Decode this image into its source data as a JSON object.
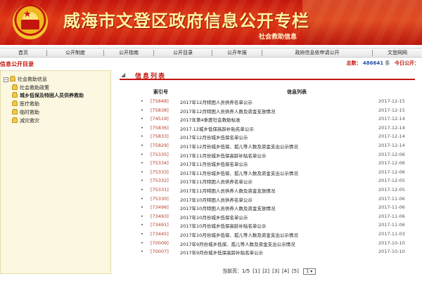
{
  "banner": {
    "title": "威海市文登区政府信息公开专栏",
    "subtitle": "社会救助信息"
  },
  "nav": {
    "items": [
      "首页",
      "公开制度",
      "公开指南",
      "公开目录",
      "公开年报",
      "政府信息依申请公开",
      "文登网网"
    ]
  },
  "sidebar": {
    "title": "信息公开目录",
    "root": "社会救助信息",
    "items": [
      {
        "label": "社会救助政策"
      },
      {
        "label": "城乡低保及特困人员供养救助"
      },
      {
        "label": "医疗救助"
      },
      {
        "label": "临时救助"
      },
      {
        "label": "减灾救灾"
      }
    ]
  },
  "stats": {
    "total_label": "总数：",
    "total_value": "486641",
    "unit": "条",
    "today_label": "今日公开："
  },
  "main": {
    "section_title": "信息列表",
    "col_code": "索引号",
    "col_title": "信息列表",
    "rows": [
      {
        "code": "[75848]",
        "title": "2017年12月特困人员供养名单公示",
        "date": "2017-12-15"
      },
      {
        "code": "[75838]",
        "title": "2017年12月特困人员供养人数及资金支放情况",
        "date": "2017-12-15"
      },
      {
        "code": "[74519]",
        "title": "2017年第4季度社会救助标准",
        "date": "2017-12-14"
      },
      {
        "code": "[75836]",
        "title": "2017.12城乡低保高龄补贴名单公示",
        "date": "2017-12-14"
      },
      {
        "code": "[75833]",
        "title": "2017年12月份城乡低保名单公示",
        "date": "2017-12-14"
      },
      {
        "code": "[75829]",
        "title": "2017年12月份城乡低保、孤儿等人数及资金支出公示情况",
        "date": "2017-12-14"
      },
      {
        "code": "[75335]",
        "title": "2017年11月份城乡低保高龄补贴名单公示",
        "date": "2017-12-06"
      },
      {
        "code": "[75334]",
        "title": "2017年11月份城乡低保名单公示",
        "date": "2017-12-06"
      },
      {
        "code": "[75333]",
        "title": "2017年11月份城乡低保、孤儿等人数及资金支出公示情况",
        "date": "2017-12-06"
      },
      {
        "code": "[75332]",
        "title": "2017年11月特困人员供养名单公示",
        "date": "2017-12-05"
      },
      {
        "code": "[75331]",
        "title": "2017年11月特困人员供养人数及资金支放情况",
        "date": "2017-12-05"
      },
      {
        "code": "[75330]",
        "title": "2017年10月特困人员供养名单公示",
        "date": "2017-11-06"
      },
      {
        "code": "[73496]",
        "title": "2017年10月特困人员供养人数及资金支放情况",
        "date": "2017-11-06"
      },
      {
        "code": "[73493]",
        "title": "2017年10月份城乡低保名单公示",
        "date": "2017-11-06"
      },
      {
        "code": "[73491]",
        "title": "2017年10月份城乡低保高龄补贴名单公示",
        "date": "2017-11-06"
      },
      {
        "code": "[73445]",
        "title": "2017年10月份城乡低保、孤儿等人数及资金支出公示情况",
        "date": "2017-11-03"
      },
      {
        "code": "[70009]",
        "title": "2017年9月份城乡低保、孤儿等人数及资金支出公示情况",
        "date": "2017-10-10"
      },
      {
        "code": "[70007]",
        "title": "2017年9月份城乡低保高龄补贴名单公示",
        "date": "2017-10-10"
      }
    ]
  },
  "pager": {
    "label": "当前页：1/5",
    "pages": [
      "[1]",
      "[2]",
      "[3]",
      "[4]",
      "[5]"
    ],
    "select_value": "1"
  },
  "colors": {
    "brand_red": "#c4160e",
    "sidebar_bg": "#fbf7e0",
    "code_red": "#b53a2a"
  }
}
